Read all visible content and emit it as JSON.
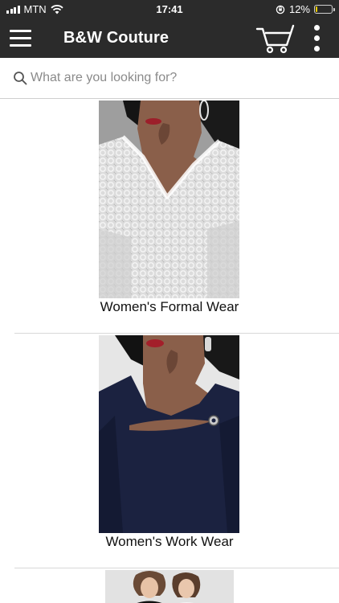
{
  "status_bar": {
    "carrier": "MTN",
    "time": "17:41",
    "battery_percent": "12%",
    "battery_level": 0.12
  },
  "header": {
    "title": "B&W Couture",
    "icons": [
      "menu-icon",
      "cart-icon",
      "more-vertical-icon"
    ]
  },
  "search": {
    "placeholder": "What are you looking for?",
    "value": ""
  },
  "categories": [
    {
      "label": "Women's Formal Wear"
    },
    {
      "label": "Women's Work Wear"
    },
    {
      "label": ""
    }
  ],
  "colors": {
    "header_background": "#2b2b2b",
    "header_text": "#ffffff",
    "page_background": "#ffffff",
    "divider": "#d8d8d8"
  }
}
